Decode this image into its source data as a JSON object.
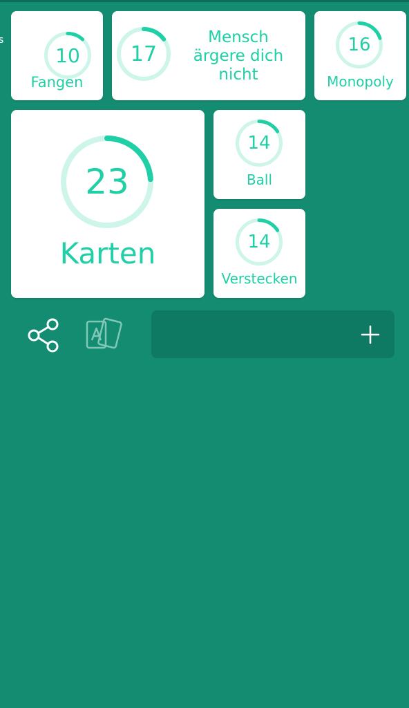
{
  "theme": {
    "background": "#138c72",
    "accent": "#1fcfa6",
    "ring_track": "#cdf5ea",
    "input_bar": "#0f7a63"
  },
  "edge_mark": "s",
  "tiles": {
    "fangen": {
      "count": "10",
      "label": "Fangen",
      "progress": 0.12
    },
    "mensch": {
      "count": "17",
      "label_lines": [
        "Mensch",
        "ärgere dich",
        "nicht"
      ],
      "progress": 0.15
    },
    "monopoly": {
      "count": "16",
      "label": "Monopoly",
      "progress": 0.2
    },
    "karten": {
      "count": "23",
      "label": "Karten",
      "progress": 0.24
    },
    "ball": {
      "count": "14",
      "label": "Ball",
      "progress": 0.16
    },
    "verstecken": {
      "count": "14",
      "label": "Verstecken",
      "progress": 0.16
    }
  },
  "actions": {
    "share_icon": "share-icon",
    "cards_icon": "cards-icon"
  },
  "input": {
    "value": "",
    "placeholder": "",
    "plus_icon": "plus-icon"
  }
}
